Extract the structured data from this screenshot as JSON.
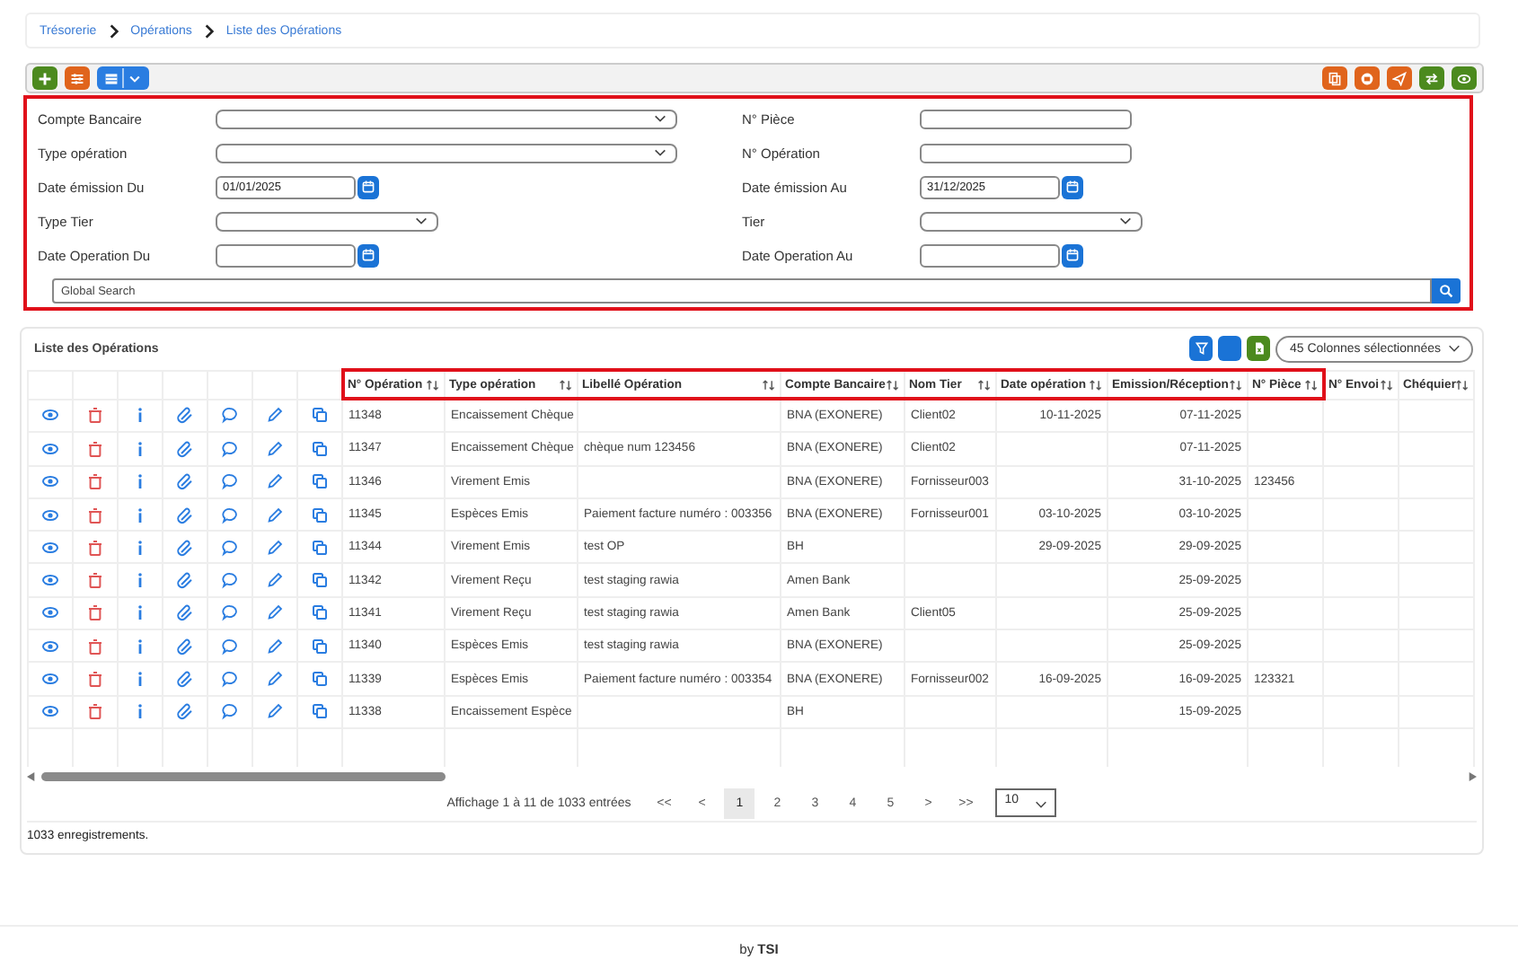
{
  "breadcrumb": [
    "Trésorerie",
    "Opérations",
    "Liste des Opérations"
  ],
  "toolbar": {
    "left": [
      {
        "color": "#4c8a1e"
      },
      {
        "color": "#e0641c"
      },
      {
        "color": "#2a7de1"
      }
    ],
    "right": [
      {
        "color": "#e0641c"
      },
      {
        "color": "#e0641c"
      },
      {
        "color": "#e0641c"
      },
      {
        "color": "#4c8a1e"
      },
      {
        "color": "#4c8a1e"
      }
    ]
  },
  "filters": {
    "highlighted": true,
    "fields": [
      {
        "label": "Compte Bancaire",
        "kind": "wide-select"
      },
      {
        "label": "N° Pièce",
        "kind": "text"
      },
      {
        "label": "Type opération",
        "kind": "wide-select"
      },
      {
        "label": "N° Opération",
        "kind": "text"
      },
      {
        "label": "Date émission Du",
        "kind": "date",
        "value": "01/01/2025"
      },
      {
        "label": "Date émission Au",
        "kind": "date",
        "value": "31/12/2025"
      },
      {
        "label": "Type Tier",
        "kind": "select"
      },
      {
        "label": "Tier",
        "kind": "select"
      },
      {
        "label": "Date Operation Du",
        "kind": "date"
      },
      {
        "label": "Date Operation Au",
        "kind": "date"
      }
    ],
    "search": {
      "placeholder": "Global Search"
    }
  },
  "table": {
    "title": "Liste des Opérations",
    "columns_picker": "45 Colonnes sélectionnées",
    "columns": [
      {
        "label": "N° Opération",
        "kind": "text",
        "highlighted": true
      },
      {
        "label": "Type opération",
        "kind": "text",
        "highlighted": true
      },
      {
        "label": "Libellé Opération",
        "kind": "text",
        "highlighted": true
      },
      {
        "label": "Compte Bancaire",
        "kind": "text",
        "highlighted": true
      },
      {
        "label": "Nom Tier",
        "kind": "text",
        "highlighted": true
      },
      {
        "label": "Date opération",
        "kind": "date",
        "highlighted": true
      },
      {
        "label": "Emission/Réception",
        "kind": "date",
        "highlighted": true
      },
      {
        "label": "N° Pièce",
        "kind": "text",
        "highlighted": true
      },
      {
        "label": "N° Envoi",
        "kind": "text",
        "highlighted": false
      },
      {
        "label": "Chéquier",
        "kind": "text",
        "highlighted": false
      }
    ],
    "rows": [
      [
        "11348",
        "Encaissement Chèque",
        null,
        "BNA (EXONERE)",
        "Client02",
        "10-11-2025",
        "07-11-2025",
        null,
        null,
        null
      ],
      [
        "11347",
        "Encaissement Chèque",
        "chèque num 123456",
        "BNA (EXONERE)",
        "Client02",
        null,
        "07-11-2025",
        null,
        null,
        null
      ],
      [
        "11346",
        "Virement Emis",
        null,
        "BNA (EXONERE)",
        "Fornisseur003",
        null,
        "31-10-2025",
        "123456",
        null,
        null
      ],
      [
        "11345",
        "Espèces Emis",
        "Paiement facture numéro : 003356",
        "BNA (EXONERE)",
        "Fornisseur001",
        "03-10-2025",
        "03-10-2025",
        null,
        null,
        null
      ],
      [
        "11344",
        "Virement Emis",
        "test OP",
        "BH",
        null,
        "29-09-2025",
        "29-09-2025",
        null,
        null,
        null
      ],
      [
        "11342",
        "Virement Reçu",
        "test staging rawia",
        "Amen Bank",
        null,
        null,
        "25-09-2025",
        null,
        null,
        null
      ],
      [
        "11341",
        "Virement Reçu",
        "test staging rawia",
        "Amen Bank",
        "Client05",
        null,
        "25-09-2025",
        null,
        null,
        null
      ],
      [
        "11340",
        "Espèces Emis",
        "test staging rawia",
        "BNA (EXONERE)",
        null,
        null,
        "25-09-2025",
        null,
        null,
        null
      ],
      [
        "11339",
        "Espèces Emis",
        "Paiement facture numéro : 003354",
        "BNA (EXONERE)",
        "Fornisseur002",
        "16-09-2025",
        "16-09-2025",
        "123321",
        null,
        null
      ],
      [
        "11338",
        "Encaissement Espèce",
        null,
        "BH",
        null,
        null,
        "15-09-2025",
        null,
        null,
        null
      ]
    ],
    "pagination": {
      "info": "Affichage 1 à 11 de 1033 entrées",
      "first": "<<",
      "prev": "<",
      "pages": [
        {
          "label": "1",
          "selected": true
        },
        {
          "label": "2",
          "selected": false
        },
        {
          "label": "3",
          "selected": false
        },
        {
          "label": "4",
          "selected": false
        },
        {
          "label": "5",
          "selected": false
        }
      ],
      "next": ">",
      "last": ">>",
      "page_size": "10"
    },
    "count": "1033 enregistrements."
  },
  "footer": "by **TSI**"
}
